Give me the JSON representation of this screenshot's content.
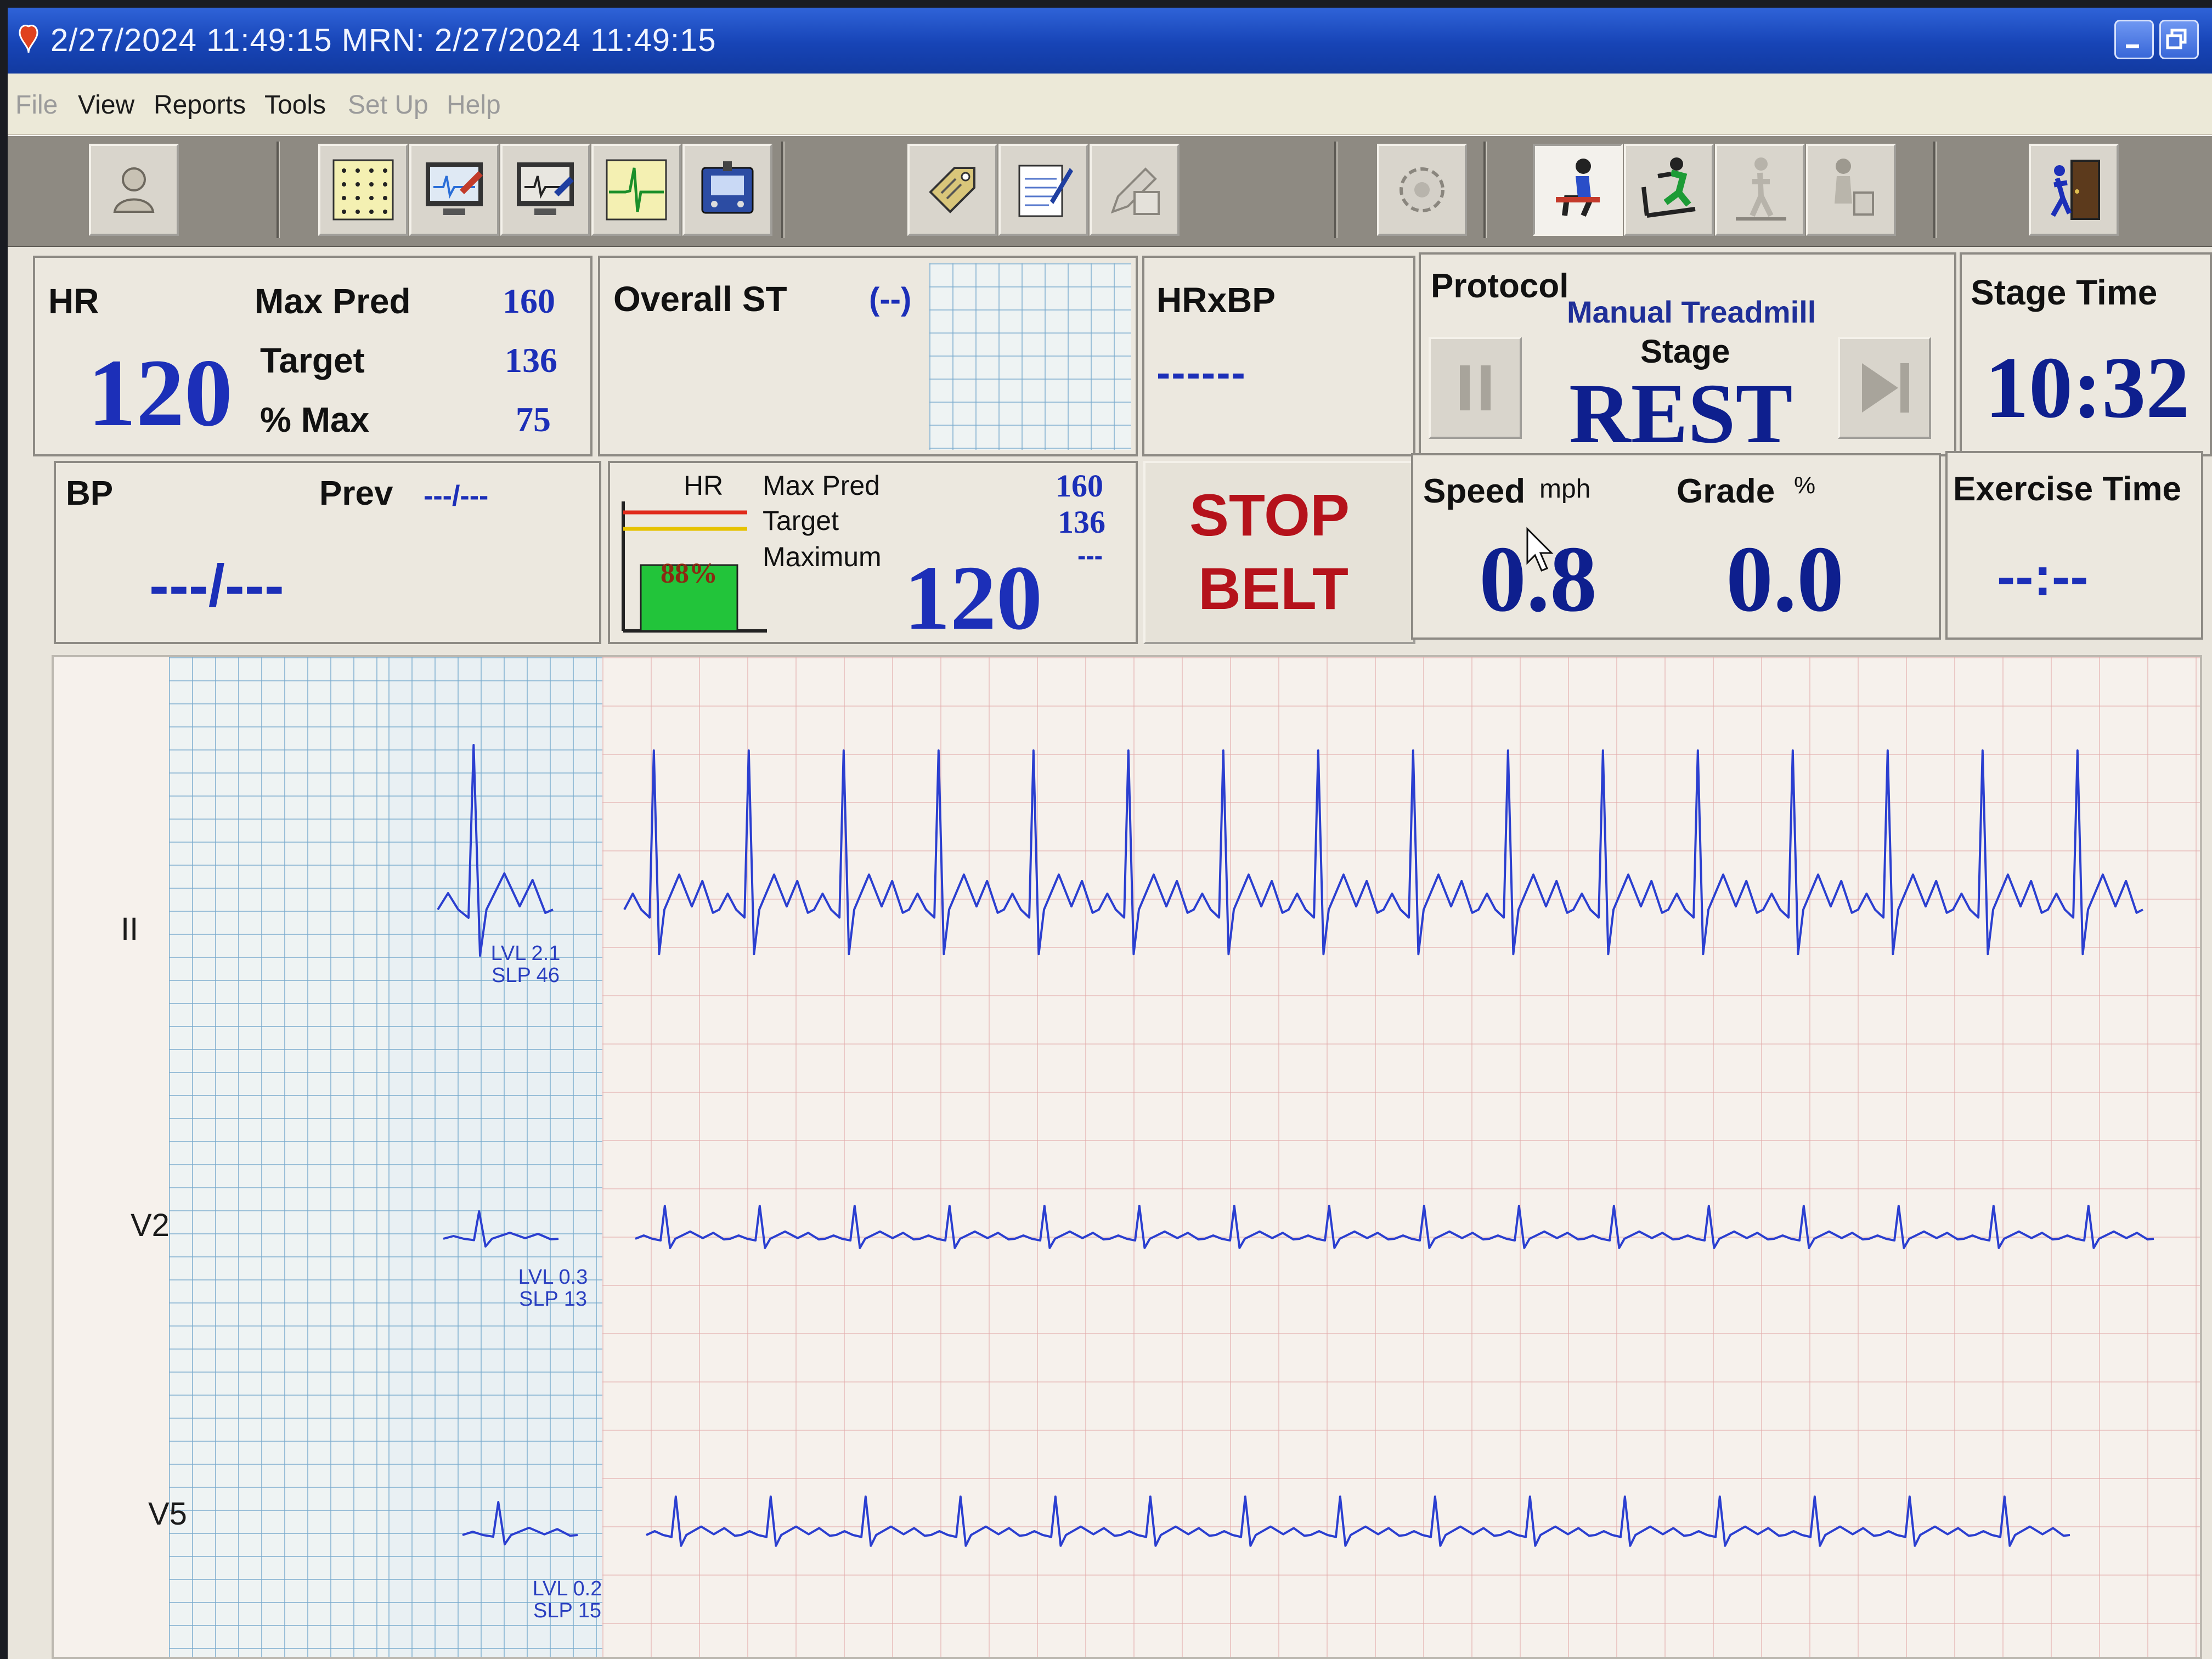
{
  "window": {
    "title": "2/27/2024 11:49:15   MRN: 2/27/2024 11:49:15"
  },
  "menu": [
    {
      "label": "File",
      "enabled": false
    },
    {
      "label": "View",
      "enabled": true
    },
    {
      "label": "Reports",
      "enabled": true
    },
    {
      "label": "Tools",
      "enabled": true
    },
    {
      "label": "Set Up",
      "enabled": false
    },
    {
      "label": "Help",
      "enabled": false
    }
  ],
  "toolbar": {
    "icons": [
      "patient-icon",
      "grid-icon",
      "monitor-edit-icon",
      "monitor-review-icon",
      "ecg-trace-icon",
      "device-icon",
      "tag-icon",
      "notepad-icon",
      "pen-icon",
      "settings-gear-icon",
      "seated-patient-icon",
      "treadmill-runner-icon",
      "walking-icon",
      "recovery-icon",
      "exit-door-icon"
    ]
  },
  "hr_panel": {
    "label": "HR",
    "value": "120",
    "max_pred_label": "Max Pred",
    "max_pred": "160",
    "target_label": "Target",
    "target": "136",
    "pct_max_label": "% Max",
    "pct_max": "75"
  },
  "overall_st": {
    "label": "Overall ST",
    "value": "(--)"
  },
  "hrxbp": {
    "label": "HRxBP",
    "value": "------"
  },
  "protocol": {
    "label": "Protocol",
    "name": "Manual Treadmill",
    "stage_label": "Stage",
    "stage": "REST"
  },
  "stage_time": {
    "label": "Stage Time",
    "value": "10:32"
  },
  "bp": {
    "label": "BP",
    "prev_label": "Prev",
    "prev": "---/---",
    "value": "---/---"
  },
  "hr_gauge": {
    "label": "HR",
    "percent_text": "88%",
    "percent": 0.88,
    "max_pred_label": "Max Pred",
    "max_pred": "160",
    "target_label": "Target",
    "target": "136",
    "maximum_label": "Maximum",
    "maximum": "---",
    "current": "120",
    "colors": {
      "max_line": "#e02a1a",
      "target_line": "#e6c200",
      "bar": "#22c43a"
    }
  },
  "stop_belt": {
    "line1": "STOP",
    "line2": "BELT"
  },
  "speed_grade": {
    "speed_label": "Speed",
    "speed_unit": "mph",
    "speed": "0.8",
    "grade_label": "Grade",
    "grade_unit": "%",
    "grade": "0.0"
  },
  "exercise_time": {
    "label": "Exercise Time",
    "value": "--:--"
  },
  "leads": [
    {
      "name": "II",
      "lvl": "LVL 2.1",
      "slp": "SLP 46"
    },
    {
      "name": "V2",
      "lvl": "LVL 0.3",
      "slp": "SLP 13"
    },
    {
      "name": "V5",
      "lvl": "LVL 0.2",
      "slp": "SLP 15"
    }
  ],
  "colors": {
    "title_bar": "#1744b6",
    "value_blue": "#1c2fb8",
    "stop_red": "#b5121b",
    "ecg_trace": "#2b3fd0"
  }
}
